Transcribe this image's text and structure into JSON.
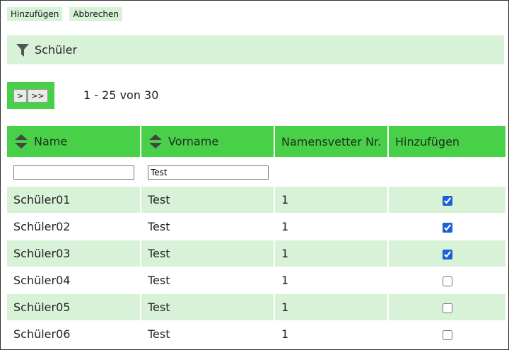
{
  "toolbar": {
    "add_label": "Hinzufügen",
    "cancel_label": "Abbrechen"
  },
  "filter_panel": {
    "title": "Schüler",
    "icon": "filter-icon"
  },
  "pager": {
    "next_label": ">",
    "last_label": ">>",
    "range_text": "1 - 25 von 30"
  },
  "table": {
    "columns": [
      "Name",
      "Vorname",
      "Namensvetter Nr.",
      "Hinzufügen"
    ],
    "filters": {
      "name": "",
      "vorname": "Test"
    },
    "rows": [
      {
        "name": "Schüler01",
        "vorname": "Test",
        "nr": "1",
        "checked": true
      },
      {
        "name": "Schüler02",
        "vorname": "Test",
        "nr": "1",
        "checked": true
      },
      {
        "name": "Schüler03",
        "vorname": "Test",
        "nr": "1",
        "checked": true
      },
      {
        "name": "Schüler04",
        "vorname": "Test",
        "nr": "1",
        "checked": false
      },
      {
        "name": "Schüler05",
        "vorname": "Test",
        "nr": "1",
        "checked": false
      },
      {
        "name": "Schüler06",
        "vorname": "Test",
        "nr": "1",
        "checked": false
      }
    ]
  },
  "colors": {
    "accent_green": "#48d048",
    "light_green": "#d8f2d8",
    "checkbox_blue": "#1c5fd6"
  }
}
